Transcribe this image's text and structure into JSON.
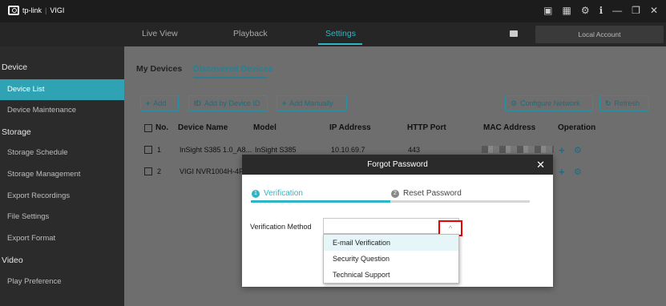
{
  "app": {
    "brand": "tp-link",
    "separator": "|",
    "product": "VIGI"
  },
  "nav": {
    "tabs": [
      "Live View",
      "Playback",
      "Settings"
    ],
    "account": "Local Account"
  },
  "sidebar": {
    "groups": [
      {
        "title": "Device",
        "items": [
          "Device List",
          "Device Maintenance"
        ]
      },
      {
        "title": "Storage",
        "items": [
          "Storage Schedule",
          "Storage Management",
          "Export Recordings",
          "File Settings",
          "Export Format"
        ]
      },
      {
        "title": "Video",
        "items": [
          "Play Preference"
        ]
      }
    ],
    "active": "Device List"
  },
  "main": {
    "tabs": [
      "My Devices",
      "Discovered Devices"
    ],
    "active_tab": "Discovered Devices",
    "buttons": {
      "add": "Add",
      "add_by_id": "Add by Device ID",
      "add_manually": "Add Manually",
      "configure_network": "Configure Network",
      "refresh": "Refresh"
    },
    "columns": [
      "No.",
      "Device Name",
      "Model",
      "IP Address",
      "HTTP Port",
      "MAC Address",
      "Operation"
    ],
    "rows": [
      {
        "no": "1",
        "name": "InSight S385 1.0_A8...",
        "model": "InSight S385",
        "ip": "10.10.69.7",
        "port": "443"
      },
      {
        "no": "2",
        "name": "VIGI NVR1004H-4P",
        "model": "",
        "ip": "",
        "port": ""
      }
    ]
  },
  "modal": {
    "title": "Forgot Password",
    "steps": [
      {
        "num": "1",
        "label": "Verification"
      },
      {
        "num": "2",
        "label": "Reset Password"
      }
    ],
    "progress": 0.5,
    "verification_label": "Verification Method",
    "options": [
      "E-mail Verification",
      "Security Question",
      "Technical Support"
    ],
    "highlighted_option": "E-mail Verification"
  },
  "colors": {
    "accent": "#2fb6c6",
    "highlight_box": "#e00000"
  }
}
